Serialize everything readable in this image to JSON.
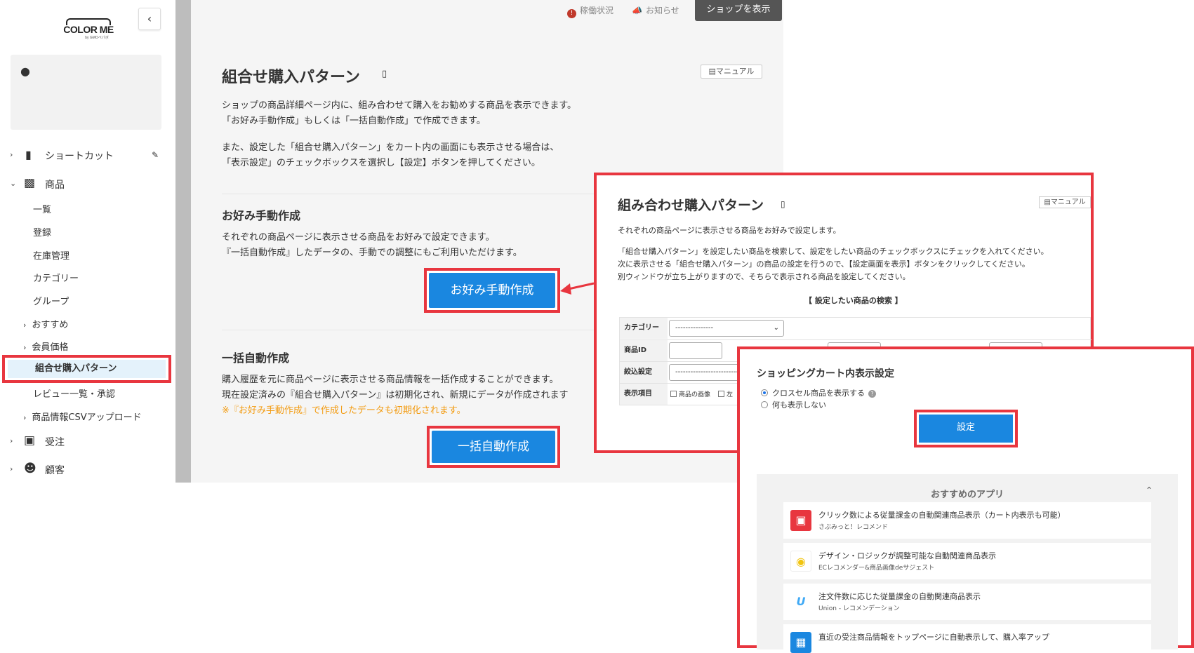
{
  "sidebar": {
    "logo_text": "COLOR ME",
    "logo_sub": "by GMOペパボ",
    "collapse_icon": "chevron-left",
    "shortcut": "ショートカット",
    "product": "商品",
    "items": [
      "一覧",
      "登録",
      "在庫管理",
      "カテゴリー",
      "グループ"
    ],
    "recommend": "おすすめ",
    "member_price": "会員価格",
    "active_item": "組合せ購入パターン",
    "review": "レビュー一覧・承認",
    "csv": "商品情報CSVアップロード",
    "orders": "受注",
    "customers": "顧客"
  },
  "topbar": {
    "status": "稼働状況",
    "news": "お知らせ",
    "show_shop": "ショップを表示"
  },
  "main": {
    "title": "組合せ購入パターン",
    "manual": "マニュアル",
    "desc1": "ショップの商品詳細ページ内に、組み合わせて購入をお勧めする商品を表示できます。",
    "desc2": "「お好み手動作成」もしくは「一括自動作成」で作成できます。",
    "desc3": "また、設定した「組合せ購入パターン」をカート内の画面にも表示させる場合は、",
    "desc4": "「表示設定」のチェックボックスを選択し【設定】ボタンを押してください。",
    "manual_section": {
      "title": "お好み手動作成",
      "line1": "それぞれの商品ページに表示させる商品をお好みで設定できます。",
      "line2": "『一括自動作成』したデータの、手動での調整にもご利用いただけます。",
      "button": "お好み手動作成"
    },
    "auto_section": {
      "title": "一括自動作成",
      "line1": "購入履歴を元に商品ページに表示させる商品情報を一括作成することができます。",
      "line2": "現在設定済みの『組合せ購入パターン』は初期化され、新規にデータが作成されます",
      "warning": "※『お好み手動作成』で作成したデータも初期化されます。",
      "button": "一括自動作成"
    }
  },
  "overlay1": {
    "title": "組み合わせ購入パターン",
    "manual": "マニュアル",
    "line1": "それぞれの商品ページに表示させる商品をお好みで設定します。",
    "line2": "「組合せ購入パターン」を設定したい商品を検索して、設定をしたい商品のチェックボックスにチェックを入れてください。",
    "line3": "次に表示させる「組合せ購入パターン」の商品の設定を行うので、【設定画面を表示】ボタンをクリックしてください。",
    "line4": "別ウィンドウが立ち上がりますので、そちらで表示される商品を設定してください。",
    "search_heading": "【 設定したい商品の検索 】",
    "form": {
      "category_label": "カテゴリー",
      "category_value": "---------------",
      "id_label": "商品ID",
      "filter_label": "絞込設定",
      "filter_value": "-------------------------",
      "display_label": "表示項目",
      "display_opt1": "商品の画像",
      "display_opt2": "左"
    }
  },
  "overlay2": {
    "title": "ショッピングカート内表示設定",
    "radio1": "クロスセル商品を表示する",
    "radio2": "何も表示しない",
    "set_button": "設定",
    "apps_heading": "おすすめのアプリ",
    "apps": [
      {
        "title": "クリック数による従量課金の自動関連商品表示（カート内表示も可能）",
        "sub": "さぶみっと！レコメンド",
        "icon": "cart-icon",
        "color": "#e8363f"
      },
      {
        "title": "デザイン・ロジックが調整可能な自動関連商品表示",
        "sub": "ECレコメンダー&商品画像deサジェスト",
        "icon": "recommender-icon",
        "color": "#f1c40f"
      },
      {
        "title": "注文件数に応じた従量課金の自動関連商品表示",
        "sub": "Union - レコメンデーション",
        "icon": "union-icon",
        "color": "#3fa9f5"
      },
      {
        "title": "直近の受注商品情報をトップページに自動表示して、購入率アップ",
        "sub": "",
        "icon": "shop-icon",
        "color": "#1a87e0"
      }
    ]
  }
}
